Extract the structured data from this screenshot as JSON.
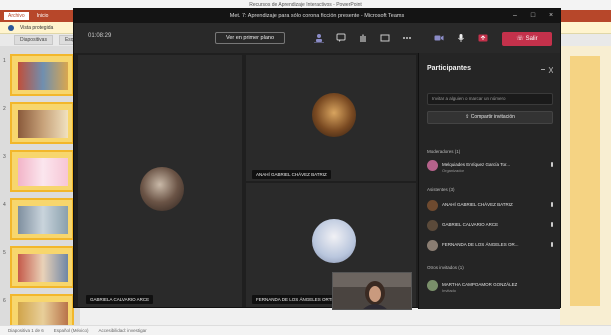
{
  "powerpoint": {
    "title": "Recursos de Aprendizaje Interactivos - PowerPoint",
    "tabs": [
      "Archivo",
      "Inicio"
    ],
    "notice": "Vista protegida",
    "mini_tabs": [
      "Diapositivas",
      "Esquema"
    ],
    "slide_numbers": [
      "1",
      "2",
      "3",
      "4",
      "5",
      "6"
    ],
    "status": [
      "Diapositiva 1 de 6",
      "Español (México)",
      "Accesibilidad: investigar"
    ]
  },
  "teams": {
    "window_title": "Met. 7: Aprendizaje para sólo corona ficción presente - Microsoft Teams",
    "timer": "01:08:29",
    "pin_button": "Ver en primer plano",
    "leave_button": "Salir",
    "tiles": [
      {
        "name": "GABRIELA CALVARIO ARCE"
      },
      {
        "name": "ANAHÍ GABRIEL CHÁVEZ BATRIZ"
      },
      {
        "name": "FERNANDA DE LOS ÁNGELES ORTIZ"
      }
    ],
    "participants": {
      "title": "Participantes",
      "search_placeholder": "Invitar a alguien o marcar un número",
      "share_invite": "Compartir invitación",
      "sections": [
        {
          "label": "Moderadores (1)",
          "people": [
            {
              "name": "Melquiades Enríquez García Tor...",
              "role": "Organizador",
              "color": "#b5628b"
            }
          ]
        },
        {
          "label": "Asistentes (3)",
          "people": [
            {
              "name": "ANAHÍ GABRIEL CHÁVEZ BATRIZ",
              "role": "",
              "color": "#6e4a2f"
            },
            {
              "name": "GABRIEL CALVARIO ARCE",
              "role": "",
              "color": "#5b4a3a"
            },
            {
              "name": "FERNANDA DE LOS ÁNGELES OR...",
              "role": "",
              "color": "#8a7d72"
            }
          ]
        },
        {
          "label": "Otros invitados (1)",
          "people": [
            {
              "name": "MARTHA CAMPOAMOR GONZÁLEZ",
              "role": "Invitado",
              "color": "#7a8f6a"
            }
          ]
        }
      ]
    }
  }
}
